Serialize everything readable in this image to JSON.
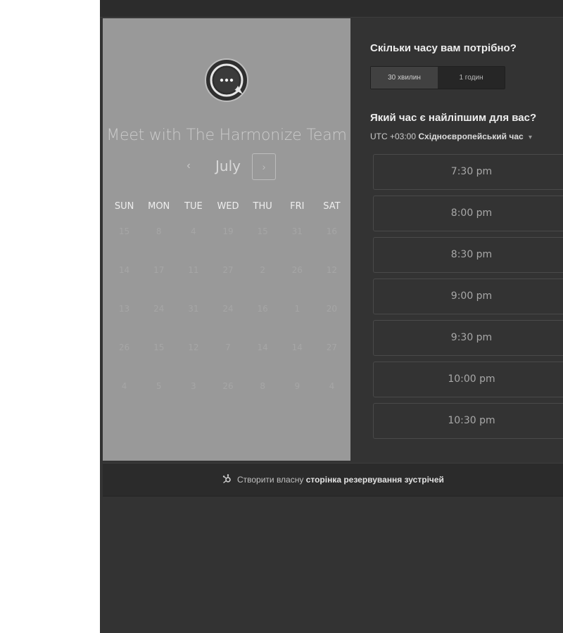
{
  "colors": {
    "page_bg": "#ffffff",
    "app_bg": "#333333",
    "calendar_panel_bg": "#999999"
  },
  "calendar": {
    "logo_icon": "chat-bubble-ellipsis-icon",
    "title": "Meet with The Harmonize Team",
    "month": "July",
    "prev_label": "‹",
    "next_label": "›",
    "weekdays": [
      "SUN",
      "MON",
      "TUE",
      "WED",
      "THU",
      "FRI",
      "SAT"
    ],
    "weeks": [
      [
        "15",
        "8",
        "4",
        "19",
        "15",
        "31",
        "16"
      ],
      [
        "14",
        "17",
        "11",
        "27",
        "2",
        "26",
        "12"
      ],
      [
        "13",
        "24",
        "31",
        "24",
        "16",
        "1",
        "20"
      ],
      [
        "26",
        "15",
        "12",
        "7",
        "14",
        "14",
        "27"
      ],
      [
        "4",
        "5",
        "3",
        "26",
        "8",
        "9",
        "4"
      ]
    ]
  },
  "booking": {
    "duration_question": "Скільки часу вам потрібно?",
    "durations": [
      "30 хвилин",
      "1 годин"
    ],
    "selected_duration": "30 хвилин",
    "time_question": "Який час є найліпшим для вас?",
    "timezone_offset": "UTC +03:00",
    "timezone_name": "Східноєвропейський час",
    "timezone_caret": "▾",
    "slots": [
      "7:30 pm",
      "8:00 pm",
      "8:30 pm",
      "9:00 pm",
      "9:30 pm",
      "10:00 pm",
      "10:30 pm"
    ]
  },
  "footer": {
    "icon": "hubspot-sprocket-icon",
    "prefix": "Створити власну",
    "link": "сторінка резервування зустрічей"
  }
}
